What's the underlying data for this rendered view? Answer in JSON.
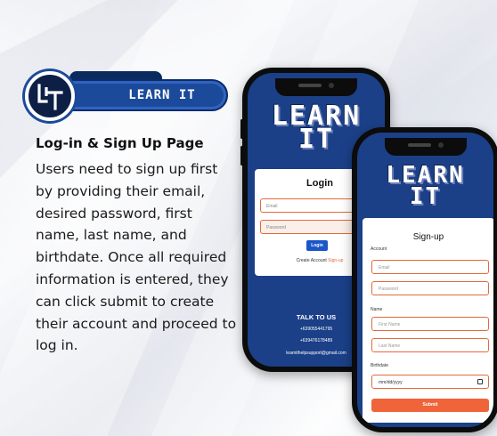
{
  "badge": {
    "logo_text": "LIT",
    "title": "LEARN IT"
  },
  "description": {
    "title": "Log-in & Sign Up Page",
    "body": "Users need to sign up first by providing their email, desired password, first name, last name, and birthdate. Once all required information is entered, they can click submit to create their account and proceed to log in."
  },
  "login_phone": {
    "brand_line1": "LEARN",
    "brand_line2": "IT",
    "card_title": "Login",
    "email_placeholder": "Email",
    "password_placeholder": "Password",
    "login_button": "Login",
    "create_account_text": "Create Account",
    "signup_link": "Sign-up",
    "talk_title": "TALK TO US",
    "phone_1": "+639055441795",
    "phone_2": "+639476178489",
    "support_email": "learnithelpsupport@gmail.com"
  },
  "signup_phone": {
    "brand_line1": "LEARN",
    "brand_line2": "IT",
    "card_title": "Sign-up",
    "account_label": "Account",
    "email_placeholder": "Email",
    "password_placeholder": "Password",
    "name_label": "Name",
    "first_name_placeholder": "First Name",
    "last_name_placeholder": "Last Name",
    "birthdate_label": "Birthdate",
    "birthdate_placeholder": "mm/dd/yyyy",
    "submit_button": "Submit"
  },
  "colors": {
    "brand_blue": "#1b4088",
    "accent_orange": "#f0643a",
    "login_button_blue": "#1a56c8"
  }
}
